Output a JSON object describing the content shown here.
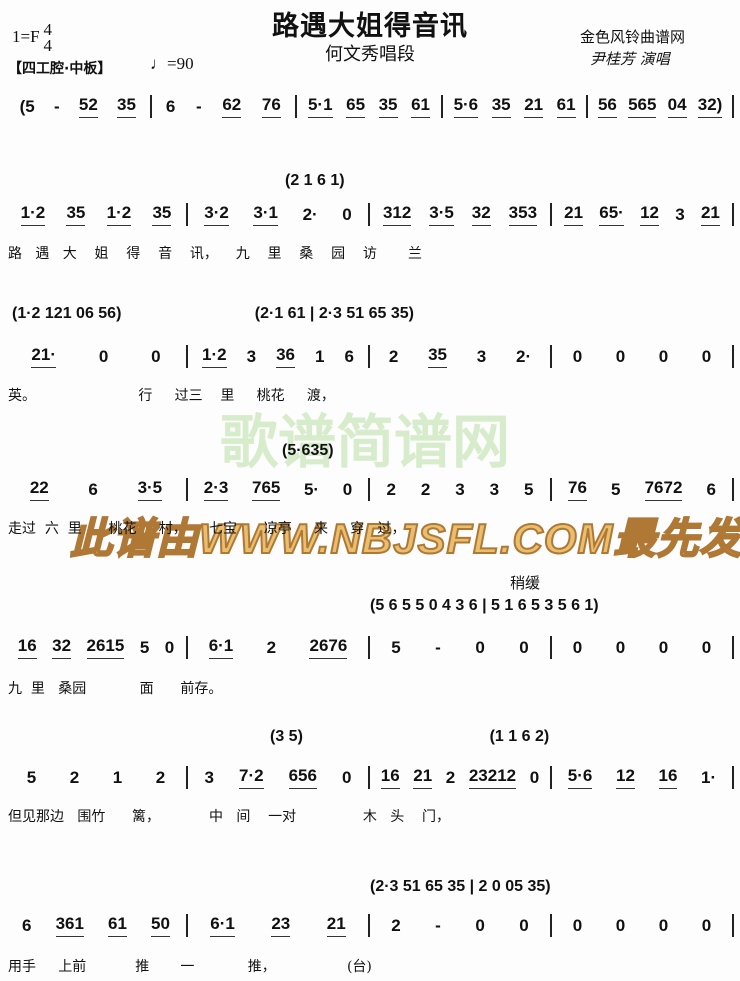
{
  "header": {
    "title": "路遇大姐得音讯",
    "subtitle": "何文秀唱段",
    "key": "1=F",
    "time_top": "4",
    "time_bottom": "4",
    "source": "金色风铃曲谱网",
    "singer": "尹桂芳 演唱",
    "tempo_mark": "【四工腔·中板】",
    "metronome": "♩=90"
  },
  "watermark": {
    "main": "此谱由WWW.NBJSFL.COM最先发布",
    "green": "歌谱简谱网"
  },
  "tempo_change": "稍缓",
  "systems": [
    {
      "interlude": "",
      "measures": [
        "(5 - 52 35",
        "6 - 62 76",
        "5·1 65 35 61",
        "5·6 35 21 61",
        "56 565 04 32)"
      ],
      "lyrics": ""
    },
    {
      "interlude": "(2 1 6 1)",
      "measures": [
        "1·2 35 1·2 35",
        "3·2 3·1 2· 0",
        "312 3·5 32 353",
        "21 65· 12 3 21"
      ],
      "lyrics": "路   遇   大    姐    得    音    讯，    九    里    桑    园    访       兰"
    },
    {
      "interlude": "(1·2 121 06 56)                              (2·1 61 | 2·3 51 65 35)",
      "measures": [
        "21·  0  0",
        "1·2 3 36 1 6",
        "2 35 3 2·",
        "0 0 0 0"
      ],
      "lyrics": "英。                       行     过三    里     桃花     渡，"
    },
    {
      "interlude": "(5·635)",
      "measures": [
        "22 6 3·5",
        "2·3 765 5· 0",
        "2 2 3 3 5",
        "76 5 7672 6"
      ],
      "lyrics": "走过  六  里      桃花     村，     七宝      凉亭     来     穿   过，"
    },
    {
      "interlude": "(5 6 5 5 0 4 3 6 | 5 1 6 5 3 5 6 1)",
      "measures": [
        "16 32 2615 5 0",
        "6·1 2 2676",
        "5 - 0 0",
        "0 0 0 0"
      ],
      "lyrics": "九  里   桑园            面      前存。"
    },
    {
      "interlude": "(3 5)                                          (1 1 6 2)",
      "measures": [
        "5 2 1 2",
        "3 7·2 656 0",
        "16 21 2 23212 0",
        "5·6 12 16 1·"
      ],
      "lyrics": "但见那边   围竹      篱，           中   间    一对               木   头    门，"
    },
    {
      "interlude": "(2·3 51 65 35 | 2 0 05 35)",
      "measures": [
        "6 361 61 50",
        "6·1 23 21",
        "2 - 0 0",
        "0 0 0 0"
      ],
      "lyrics": "用手     上前           推       一            推，                (台)"
    }
  ]
}
